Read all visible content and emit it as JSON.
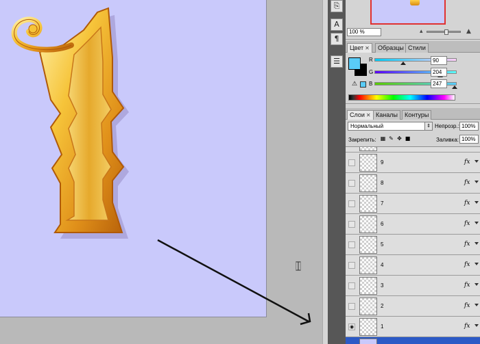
{
  "navigator": {
    "zoom_value": "100 %"
  },
  "color_panel": {
    "tabs": [
      {
        "label": "Цвет",
        "closable": true,
        "active": true
      },
      {
        "label": "Образцы",
        "closable": false,
        "active": false
      },
      {
        "label": "Стили",
        "closable": false,
        "active": false
      }
    ],
    "channels": [
      {
        "label": "R",
        "value": "90",
        "fraction": 0.35
      },
      {
        "label": "G",
        "value": "204",
        "fraction": 0.8
      },
      {
        "label": "B",
        "value": "247",
        "fraction": 0.97
      }
    ],
    "foreground_color": "#5accf7",
    "background_color": "#000000"
  },
  "layers_panel": {
    "tabs": [
      {
        "label": "Слои",
        "closable": true,
        "active": true
      },
      {
        "label": "Каналы",
        "closable": false,
        "active": false
      },
      {
        "label": "Контуры",
        "closable": false,
        "active": false
      }
    ],
    "blend_mode": "Нормальный",
    "opacity_label": "Непрозр.:",
    "opacity_value": "100%",
    "lock_label": "Закрепить:",
    "fill_label": "Заливка:",
    "fill_value": "100%",
    "layers": [
      {
        "name": "9",
        "visible": false,
        "fx": true
      },
      {
        "name": "8",
        "visible": false,
        "fx": true
      },
      {
        "name": "7",
        "visible": false,
        "fx": true
      },
      {
        "name": "6",
        "visible": false,
        "fx": true
      },
      {
        "name": "5",
        "visible": false,
        "fx": true
      },
      {
        "name": "4",
        "visible": false,
        "fx": true
      },
      {
        "name": "3",
        "visible": false,
        "fx": true
      },
      {
        "name": "2",
        "visible": false,
        "fx": true
      },
      {
        "name": "1",
        "visible": true,
        "fx": true
      }
    ]
  },
  "icons": {
    "visibility": "eye-icon",
    "effects": "fx-icon"
  }
}
